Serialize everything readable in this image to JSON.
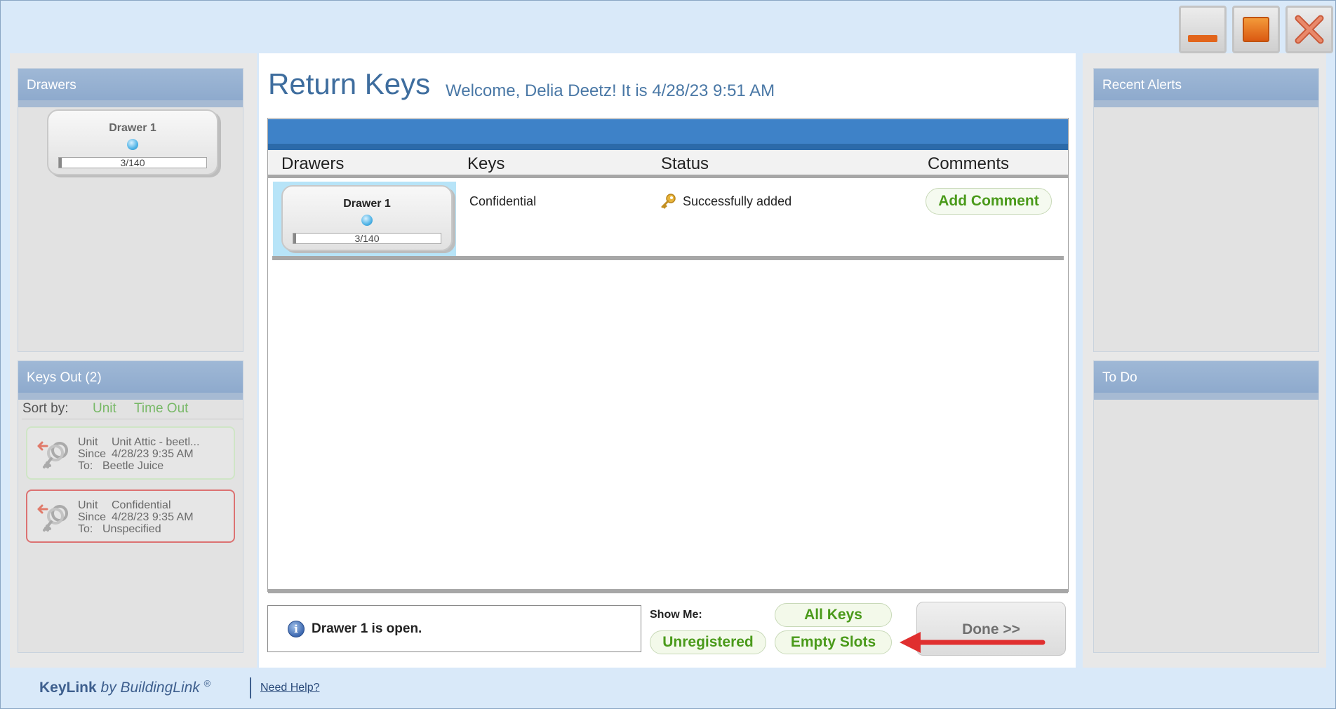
{
  "window": {
    "minimize_icon": "minimize-icon",
    "maximize_icon": "maximize-icon",
    "close_icon": "close-icon"
  },
  "left_panels": {
    "drawers_title": "Drawers",
    "drawer": {
      "name": "Drawer 1",
      "count": "3/140"
    },
    "keys_out_title": "Keys Out (2)",
    "sort_by_label": "Sort by:",
    "sort_options": [
      "Unit",
      "Time Out"
    ],
    "keys_out": [
      {
        "unit_label": "Unit",
        "unit": "Unit Attic - beetl...",
        "since_label": "Since",
        "since": "4/28/23 9:35 AM",
        "to_label": "To:",
        "to": "Beetle Juice"
      },
      {
        "unit_label": "Unit",
        "unit": "Confidential",
        "since_label": "Since",
        "since": "4/28/23 9:35 AM",
        "to_label": "To:",
        "to": "Unspecified"
      }
    ]
  },
  "right_panels": {
    "recent_alerts_title": "Recent Alerts",
    "todo_title": "To Do"
  },
  "main": {
    "title": "Return Keys",
    "welcome": "Welcome, Delia Deetz! It is 4/28/23 9:51 AM",
    "columns": [
      "Drawers",
      "Keys",
      "Status",
      "Comments"
    ],
    "row": {
      "drawer_name": "Drawer 1",
      "drawer_count": "3/140",
      "key": "Confidential",
      "status": "Successfully added",
      "comment_button": "Add Comment"
    },
    "message": "Drawer 1 is open.",
    "show_me_label": "Show Me:",
    "filters": {
      "all_keys": "All Keys",
      "unregistered": "Unregistered",
      "empty_slots": "Empty Slots"
    },
    "done_button": "Done >>"
  },
  "footer": {
    "brand_bold": "KeyLink",
    "brand_rest": " by BuildingLink",
    "brand_mark": "®",
    "help_link": "Need Help?"
  },
  "colors": {
    "accent_blue": "#3e82c8",
    "button_green": "#4a9a1a",
    "alert_red": "#dc7272",
    "window_orange": "#e2651c"
  }
}
